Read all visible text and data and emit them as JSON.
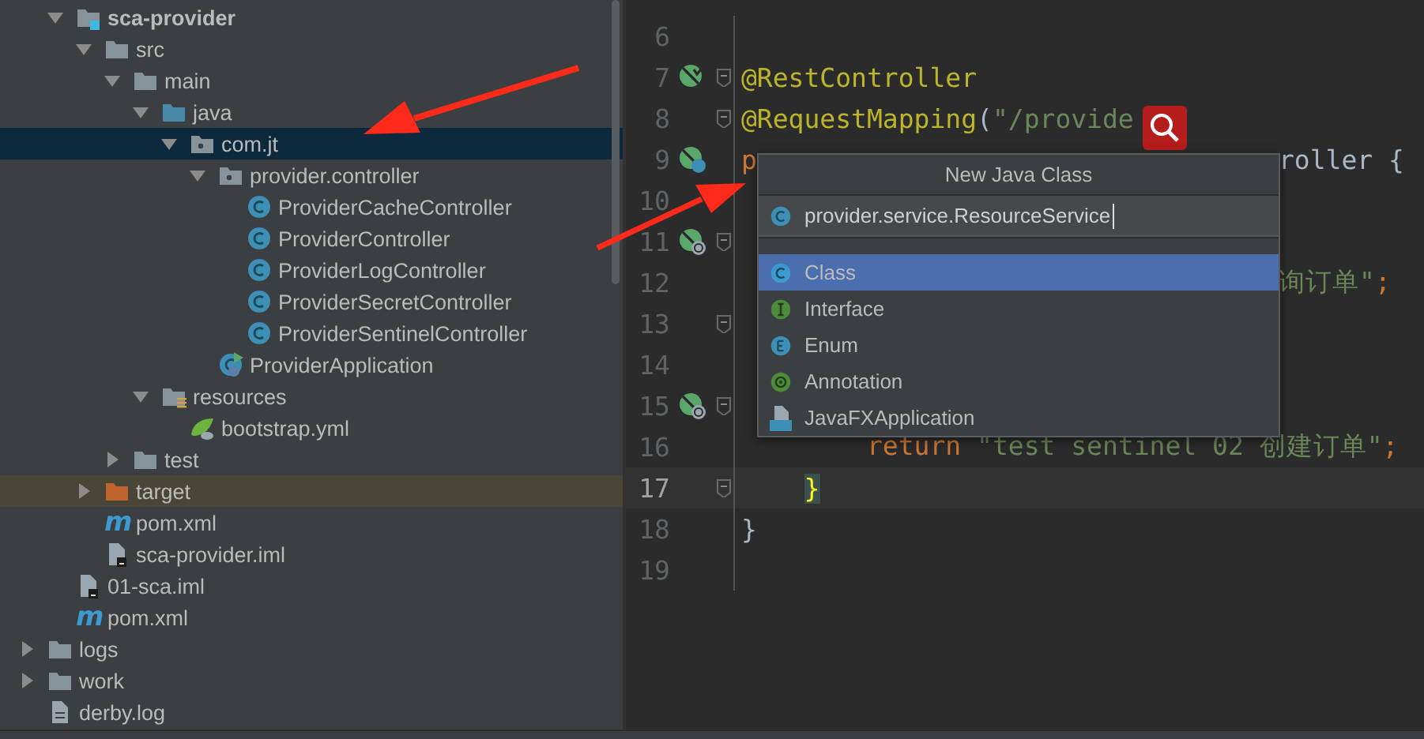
{
  "project_tree": {
    "items": [
      {
        "name": "sca-provider",
        "kind": "module",
        "expanded": true,
        "selected": false,
        "children": [
          {
            "name": "src",
            "kind": "folder",
            "expanded": true,
            "selected": false,
            "children": [
              {
                "name": "main",
                "kind": "folder",
                "expanded": true,
                "selected": false,
                "children": [
                  {
                    "name": "java",
                    "kind": "source_folder",
                    "expanded": true,
                    "selected": false,
                    "children": [
                      {
                        "name": "com.jt",
                        "kind": "package",
                        "expanded": true,
                        "selected": true,
                        "children": [
                          {
                            "name": "provider.controller",
                            "kind": "package",
                            "expanded": true,
                            "selected": false,
                            "children": [
                              {
                                "name": "ProviderCacheController",
                                "kind": "class",
                                "selected": false
                              },
                              {
                                "name": "ProviderController",
                                "kind": "class",
                                "selected": false
                              },
                              {
                                "name": "ProviderLogController",
                                "kind": "class",
                                "selected": false
                              },
                              {
                                "name": "ProviderSecretController",
                                "kind": "class",
                                "selected": false
                              },
                              {
                                "name": "ProviderSentinelController",
                                "kind": "class",
                                "selected": false
                              }
                            ]
                          },
                          {
                            "name": "ProviderApplication",
                            "kind": "app_class",
                            "selected": false
                          }
                        ]
                      }
                    ]
                  },
                  {
                    "name": "resources",
                    "kind": "resources_folder",
                    "expanded": true,
                    "selected": false,
                    "children": [
                      {
                        "name": "bootstrap.yml",
                        "kind": "yml",
                        "selected": false
                      }
                    ]
                  }
                ]
              },
              {
                "name": "test",
                "kind": "folder",
                "expanded": false,
                "selected": false
              }
            ]
          },
          {
            "name": "target",
            "kind": "excluded_folder",
            "expanded": false,
            "selected": false
          },
          {
            "name": "pom.xml",
            "kind": "maven",
            "icon_text": "m",
            "selected": false
          },
          {
            "name": "sca-provider.iml",
            "kind": "iml",
            "selected": false
          }
        ]
      },
      {
        "name": "01-sca.iml",
        "kind": "iml",
        "selected": false
      },
      {
        "name": "pom.xml",
        "kind": "maven",
        "icon_text": "m",
        "selected": false
      }
    ],
    "outer_items": [
      {
        "name": "logs",
        "kind": "folder",
        "expanded": false,
        "selected": false
      },
      {
        "name": "work",
        "kind": "folder",
        "expanded": false,
        "selected": false
      },
      {
        "name": "derby.log",
        "kind": "log",
        "selected": false
      }
    ]
  },
  "editor": {
    "lines": [
      {
        "number": "6",
        "current": false,
        "fold": false
      },
      {
        "number": "7",
        "current": false,
        "fold": true,
        "gutter": {
          "kind": "bean_check"
        },
        "tokens": [
          {
            "kind": "annotation",
            "text": "@RestController"
          }
        ]
      },
      {
        "number": "8",
        "current": false,
        "fold": true,
        "tokens": [
          {
            "kind": "annotation",
            "text": "@RequestMapping"
          },
          {
            "kind": "plain",
            "text": "("
          },
          {
            "kind": "string",
            "text": "\"/provide"
          }
        ]
      },
      {
        "number": "9",
        "current": false,
        "fold": false,
        "gutter": {
          "kind": "bean_class"
        },
        "tokens": [
          {
            "kind": "keyword",
            "text": "p"
          }
        ],
        "tokens_beside_popup": [
          {
            "kind": "plain",
            "text": "roller {"
          }
        ]
      },
      {
        "number": "10",
        "current": false,
        "fold": false
      },
      {
        "number": "11",
        "current": false,
        "fold": true,
        "gutter": {
          "kind": "web"
        }
      },
      {
        "number": "12",
        "current": false,
        "fold": false,
        "tokens_beside_popup": [
          {
            "kind": "string",
            "text": "询订单\""
          },
          {
            "kind": "keyword",
            "text": ";"
          }
        ]
      },
      {
        "number": "13",
        "current": false,
        "fold": true
      },
      {
        "number": "14",
        "current": false,
        "fold": false
      },
      {
        "number": "15",
        "current": false,
        "fold": true,
        "gutter": {
          "kind": "web"
        }
      },
      {
        "number": "16",
        "current": false,
        "fold": false,
        "tokens": [
          {
            "kind": "keyword",
            "text": "        return "
          },
          {
            "kind": "string",
            "text": "\"test sentinel 02 创建订单\""
          },
          {
            "kind": "keyword",
            "text": ";"
          }
        ]
      },
      {
        "number": "17",
        "current": true,
        "fold": true,
        "tokens": [
          {
            "kind": "brace_match",
            "text": "    }"
          }
        ]
      },
      {
        "number": "18",
        "current": false,
        "fold": false,
        "tokens": [
          {
            "kind": "plain",
            "text": "}"
          }
        ]
      },
      {
        "number": "19",
        "current": false,
        "fold": false
      }
    ]
  },
  "new_class_popup": {
    "title": "New Java Class",
    "value": "provider.service.ResourceService",
    "options": [
      {
        "label": "Class",
        "kind": "class",
        "selected": true
      },
      {
        "label": "Interface",
        "kind": "interface",
        "selected": false
      },
      {
        "label": "Enum",
        "kind": "enum",
        "selected": false
      },
      {
        "label": "Annotation",
        "kind": "annotation",
        "selected": false
      },
      {
        "label": "JavaFXApplication",
        "kind": "javafx",
        "selected": false
      }
    ]
  }
}
